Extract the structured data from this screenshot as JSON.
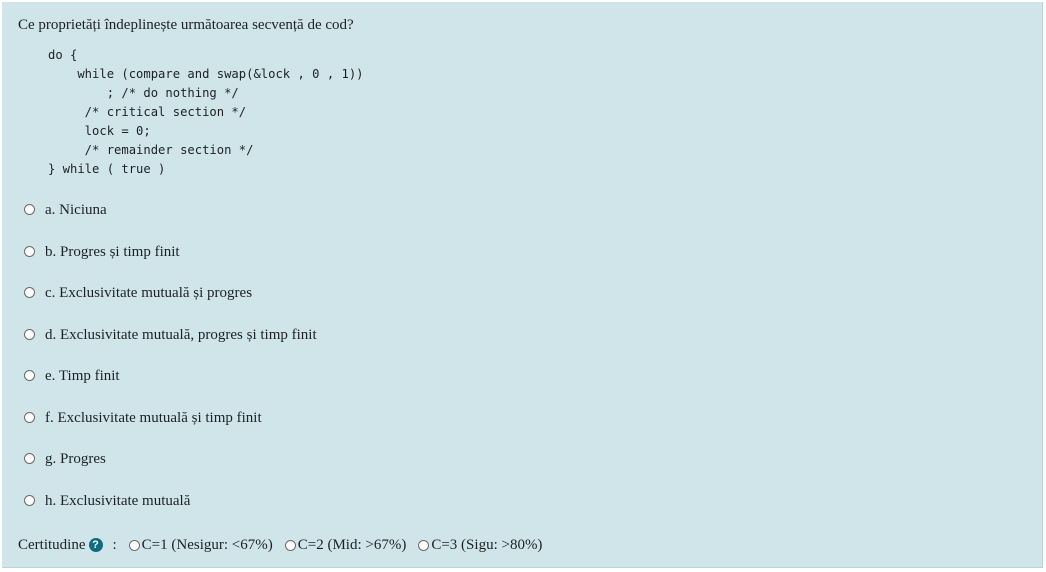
{
  "question": {
    "text": "Ce proprietăți îndeplinește următoarea secvență de cod?"
  },
  "code_lines": [
    "do {",
    "    while (compare and swap(&lock , 0 , 1))",
    "        ; /* do nothing */",
    "     /* critical section */",
    "     lock = 0;",
    "     /* remainder section */",
    "} while ( true )"
  ],
  "answers": [
    {
      "label": "a. Niciuna"
    },
    {
      "label": "b. Progres și timp finit"
    },
    {
      "label": "c. Exclusivitate mutuală și progres"
    },
    {
      "label": "d. Exclusivitate mutuală, progres și timp finit"
    },
    {
      "label": "e. Timp finit"
    },
    {
      "label": "f. Exclusivitate mutuală și timp finit"
    },
    {
      "label": "g. Progres"
    },
    {
      "label": "h. Exclusivitate mutuală"
    }
  ],
  "certitude": {
    "label": "Certitudine",
    "help_icon": "question-circle-icon",
    "separator": ":",
    "options": [
      {
        "label": "C=1 (Nesigur: <67%)"
      },
      {
        "label": "C=2 (Mid: >67%)"
      },
      {
        "label": "C=3 (Sigu: >80%)"
      }
    ]
  },
  "colors": {
    "panel_background": "#cfe5ea",
    "text": "#1d2125",
    "help_icon": "#0f6c7e"
  }
}
